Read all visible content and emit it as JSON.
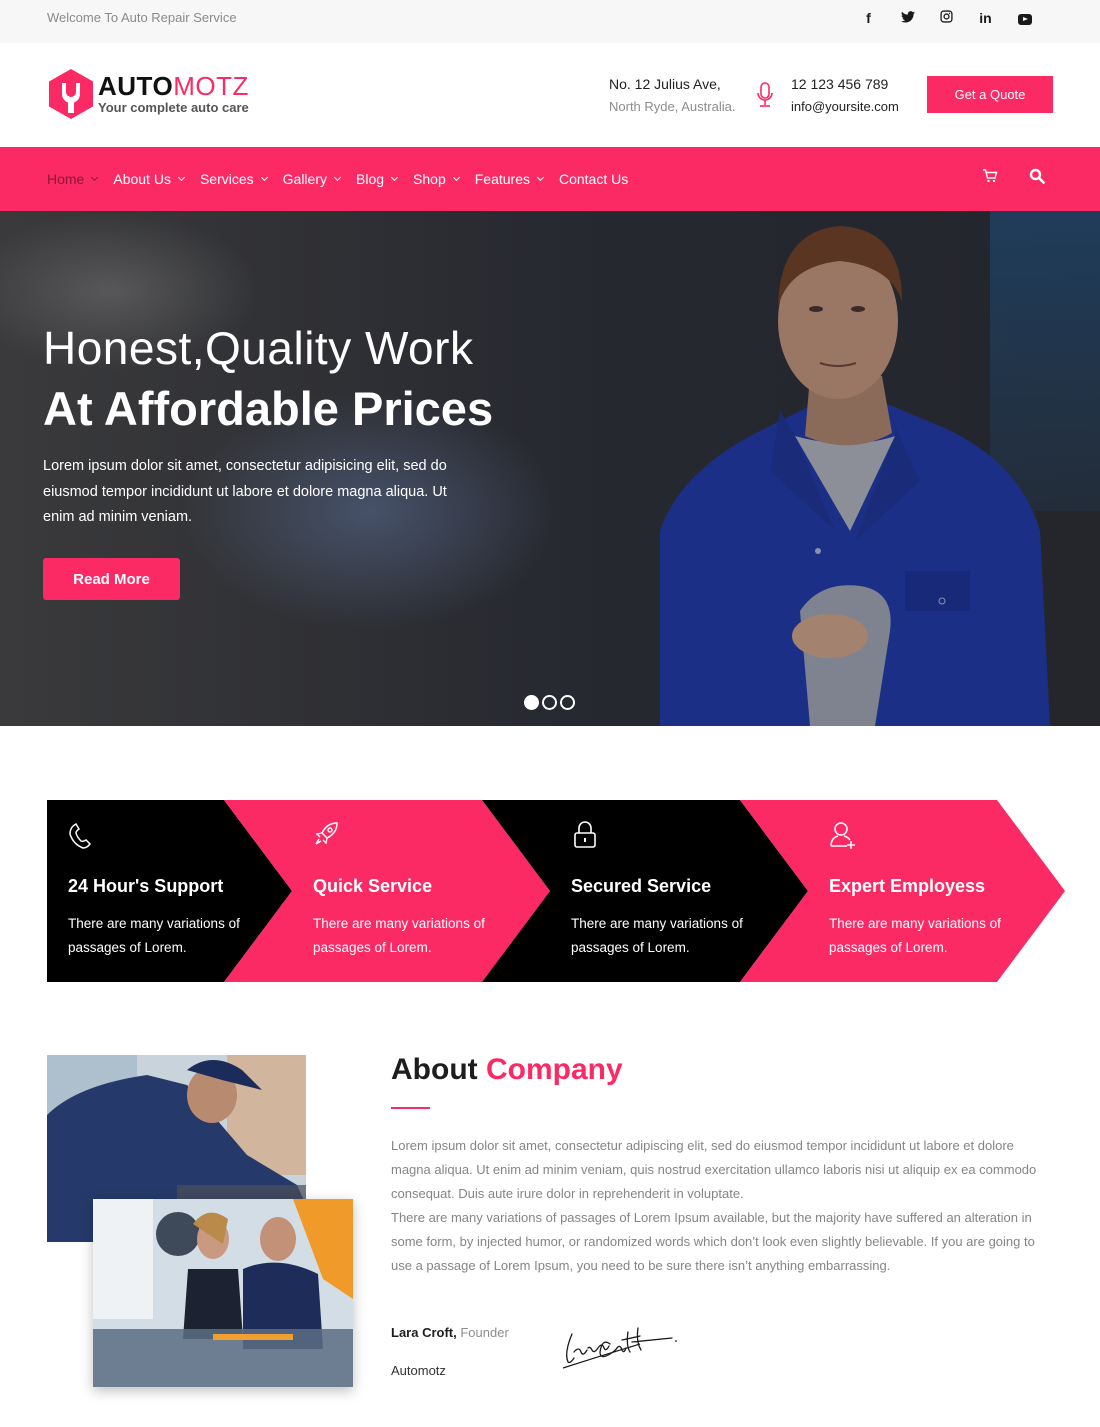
{
  "topbar": {
    "welcome": "Welcome To Auto Repair Service",
    "socials": [
      "facebook-icon",
      "twitter-icon",
      "instagram-icon",
      "linkedin-icon",
      "youtube-icon"
    ]
  },
  "brand": {
    "name_bold": "AUTO",
    "name_light": "MOTZ",
    "tagline": "Your complete auto care"
  },
  "header": {
    "address_line1": "No. 12 Julius Ave,",
    "address_line2": "North Ryde, Australia.",
    "phone": "12 123 456 789",
    "email": "info@yoursite.com",
    "quote_button": "Get a Quote"
  },
  "nav": {
    "items": [
      {
        "label": "Home",
        "dropdown": true,
        "active": true
      },
      {
        "label": "About Us",
        "dropdown": true
      },
      {
        "label": "Services",
        "dropdown": true
      },
      {
        "label": "Gallery",
        "dropdown": true
      },
      {
        "label": "Blog",
        "dropdown": true
      },
      {
        "label": "Shop",
        "dropdown": true
      },
      {
        "label": "Features",
        "dropdown": true
      },
      {
        "label": "Contact Us",
        "dropdown": false
      }
    ],
    "icons": [
      "cart-icon",
      "search-icon"
    ]
  },
  "hero": {
    "title_line1": "Honest,Quality Work",
    "title_line2": "At Affordable Prices",
    "text": "Lorem ipsum dolor sit amet, consectetur adipisicing elit, sed do eiusmod tempor incididunt ut labore et dolore magna aliqua. Ut enim ad minim veniam.",
    "button": "Read More",
    "slides_total": 3,
    "slide_active": 1
  },
  "features": [
    {
      "icon": "phone-icon",
      "title": "24 Hour's Support",
      "text": "There are many variations of passages of Lorem."
    },
    {
      "icon": "rocket-icon",
      "title": "Quick Service",
      "text": "There are many variations of passages of Lorem."
    },
    {
      "icon": "lock-icon",
      "title": "Secured Service",
      "text": "There are many variations of passages of Lorem."
    },
    {
      "icon": "add-user-icon",
      "title": "Expert Employess",
      "text": "There are many variations of passages of Lorem."
    }
  ],
  "about": {
    "title_dark": "About",
    "title_accent": "Company",
    "paragraph1": "Lorem ipsum dolor sit amet, consectetur adipiscing elit, sed do eiusmod tempor incididunt ut labore et dolore magna aliqua. Ut enim ad minim veniam, quis nostrud exercitation ullamco laboris nisi ut aliquip ex ea commodo consequat. Duis aute irure dolor in reprehenderit in voluptate.",
    "paragraph2": "There are many variations of passages of Lorem Ipsum available, but the majority have suffered an alteration in some form, by injected humor, or randomized words which don’t look even slightly believable. If you are going to use a passage of Lorem Ipsum, you need to be sure there isn’t anything embarrassing.",
    "signer_name": "Lara Croft,",
    "signer_role": "Founder",
    "company": "Automotz"
  },
  "colors": {
    "accent": "#fc2a64",
    "dark": "#000000",
    "topbar_bg": "#f7f7f7"
  }
}
